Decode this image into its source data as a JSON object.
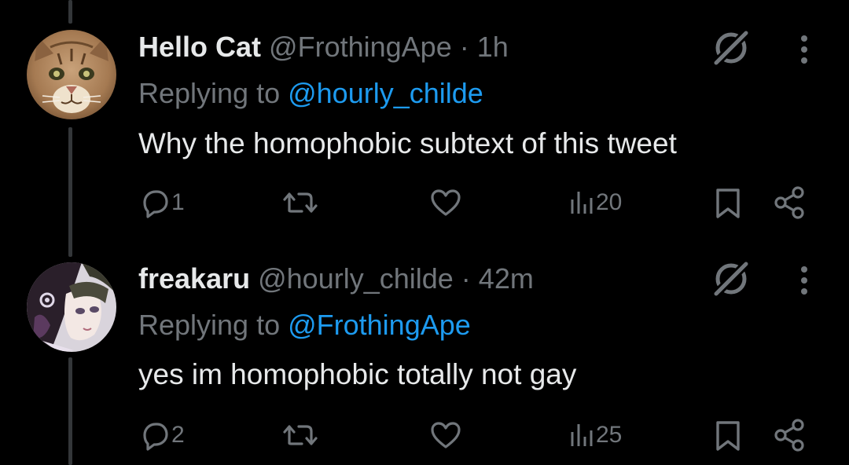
{
  "colors": {
    "background": "#000000",
    "text": "#e7e9ea",
    "muted": "#71767b",
    "link": "#1d9bf0"
  },
  "tweets": [
    {
      "display_name": "Hello Cat",
      "handle": "@FrothingApe",
      "dot": " · ",
      "time": "1h",
      "replying_prefix": "Replying to ",
      "replying_to": "@hourly_childe",
      "text": "Why the homophobic subtext of this tweet",
      "replies": "1",
      "views": "20",
      "avatar": "cat-avatar"
    },
    {
      "display_name": "freakaru",
      "handle": "@hourly_childe",
      "dot": " · ",
      "time": "42m",
      "replying_prefix": "Replying to ",
      "replying_to": "@FrothingApe",
      "text": "yes im homophobic totally not gay",
      "replies": "2",
      "views": "25",
      "avatar": "anime-avatar"
    }
  ],
  "icons": [
    "reply-icon",
    "retweet-icon",
    "like-icon",
    "views-icon",
    "bookmark-icon",
    "share-icon",
    "grok-icon",
    "more-icon"
  ]
}
